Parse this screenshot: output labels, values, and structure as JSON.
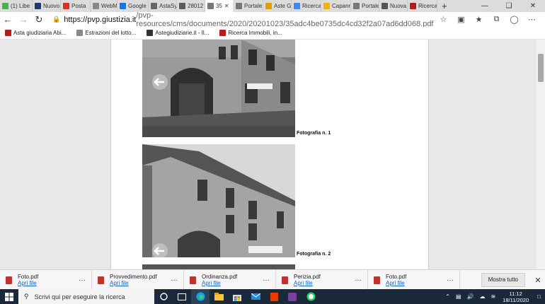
{
  "browser": {
    "tabs": [
      {
        "label": "(1) Libe",
        "color": "#4caf50"
      },
      {
        "label": "Nuovo",
        "color": "#1e3a6e",
        "glyph": "V"
      },
      {
        "label": "Posta",
        "color": "#d93025",
        "glyph": "M"
      },
      {
        "label": "WebM",
        "color": "#888888"
      },
      {
        "label": "Google",
        "color": "#1a73e8"
      },
      {
        "label": "AstaSy",
        "color": "#666666"
      },
      {
        "label": "28012",
        "color": "#5a5a5a"
      },
      {
        "label": "35",
        "color": "#777777",
        "active": true
      },
      {
        "label": "Portale",
        "color": "#777777"
      },
      {
        "label": "Aste G",
        "color": "#e0a100"
      },
      {
        "label": "Ricerca",
        "color": "#4285f4",
        "glyph": "G"
      },
      {
        "label": "Capann",
        "color": "#f2b300"
      },
      {
        "label": "Portale",
        "color": "#777777"
      },
      {
        "label": "Nuova",
        "color": "#555555"
      },
      {
        "label": "Ricerca",
        "color": "#b71c1c"
      }
    ],
    "url": {
      "domain": "https://pvp.giustizia.it",
      "path": "/pvp-resources/cms/documents/2020/20201023/35adc4be0735dc4cd32f2a07ad6dd068.pdf"
    },
    "bookmarks": [
      {
        "label": "Asta giudiziaria Abi...",
        "color": "#b71c1c"
      },
      {
        "label": "Estrazioni del lotto...",
        "color": "#888888"
      },
      {
        "label": "Astegiudiziarie.it - Il...",
        "color": "#333333"
      },
      {
        "label": "Ricerca Immobili, in...",
        "color": "#b71c1c"
      }
    ]
  },
  "document": {
    "photos": [
      {
        "caption": "Fotografia n. 1"
      },
      {
        "caption": "Fotografia n. 2"
      }
    ]
  },
  "downloads": {
    "items": [
      {
        "name": "Foto.pdf",
        "action": "Apri file"
      },
      {
        "name": "Provvedimento.pdf",
        "action": "Apri file"
      },
      {
        "name": "Ordinanza.pdf",
        "action": "Apri file"
      },
      {
        "name": "Perizia.pdf",
        "action": "Apri file"
      },
      {
        "name": "Foto.pdf",
        "action": "Apri file"
      }
    ],
    "show_all": "Mostra tutto"
  },
  "taskbar": {
    "search_placeholder": "Scrivi qui per eseguire la ricerca",
    "time": "11:12",
    "date": "18/11/2020"
  }
}
